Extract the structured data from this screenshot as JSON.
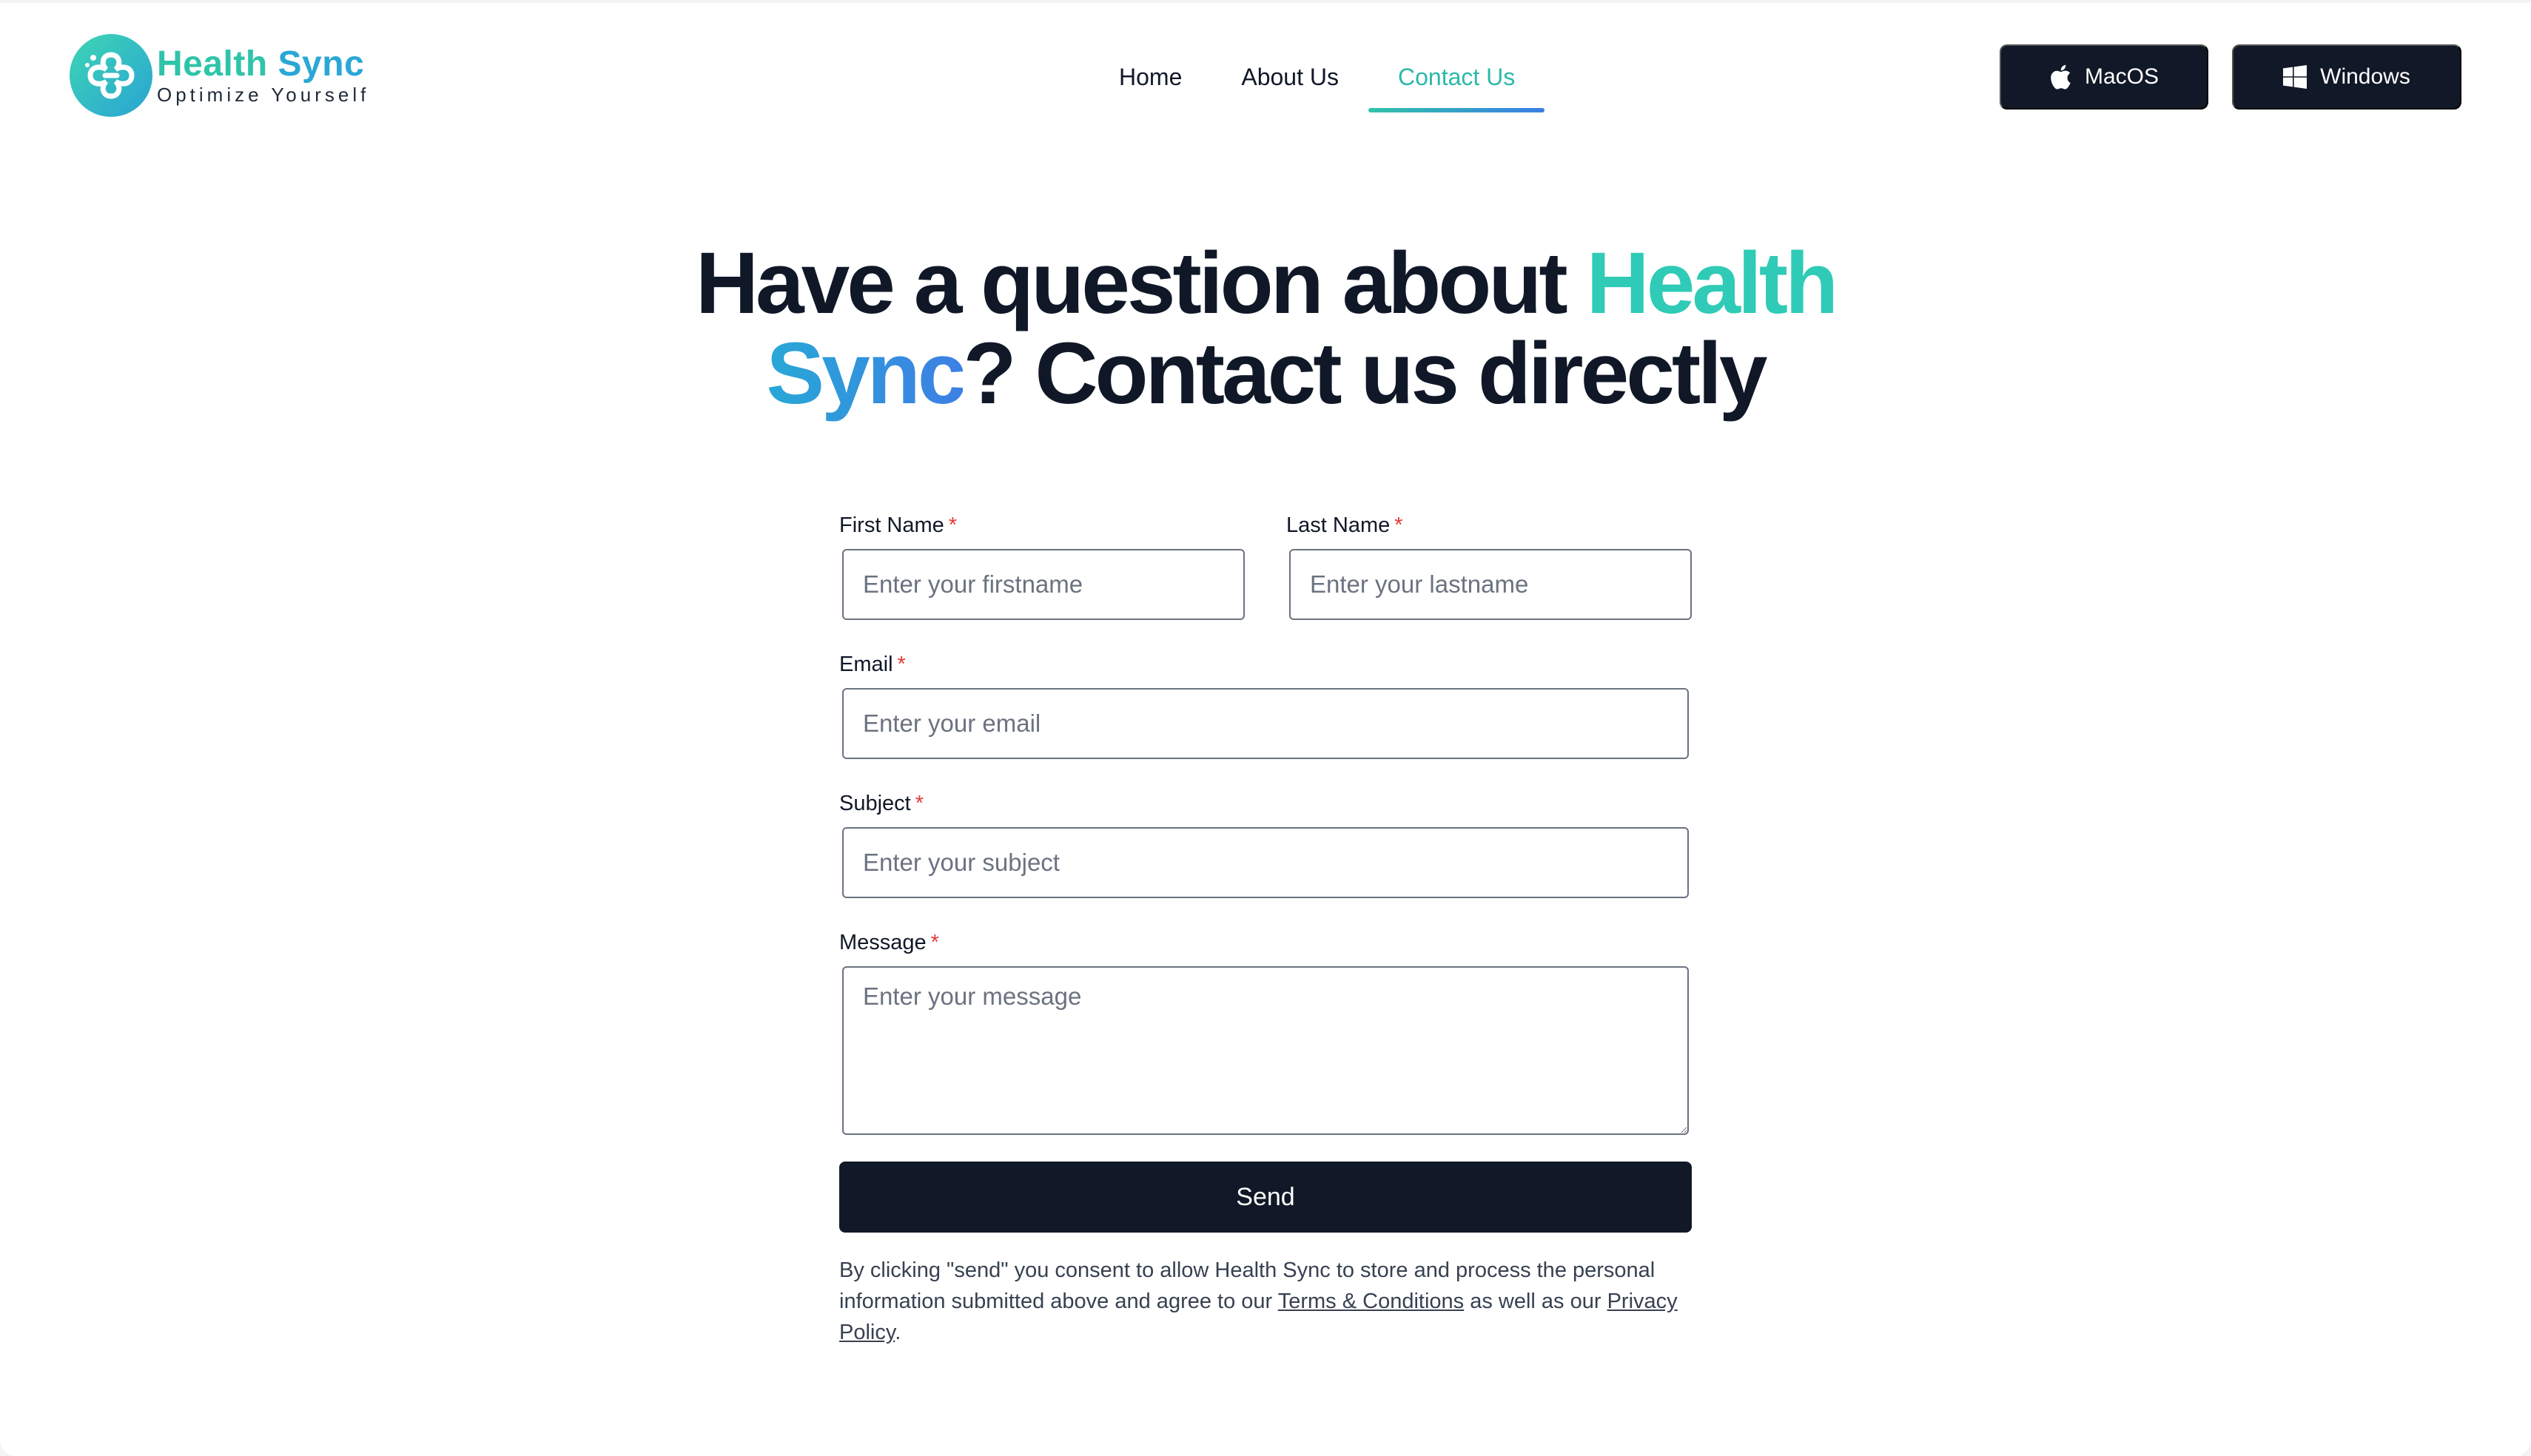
{
  "brand": {
    "name_part1": "Health",
    "name_part2": " Sync",
    "tagline": "Optimize Yourself",
    "colors": {
      "teal": "#2fc4a8",
      "blue": "#3b7ee6",
      "dark": "#111827"
    }
  },
  "nav": {
    "items": [
      {
        "label": "Home",
        "active": false
      },
      {
        "label": "About Us",
        "active": false
      },
      {
        "label": "Contact Us",
        "active": true
      }
    ]
  },
  "downloads": {
    "mac": {
      "label": "MacOS",
      "icon": "apple-icon"
    },
    "windows": {
      "label": "Windows",
      "icon": "windows-icon"
    }
  },
  "hero": {
    "part1": "Have a question about ",
    "accent1": "Health",
    "accent2": "Sync",
    "part2": "? Contact us directly"
  },
  "form": {
    "first_name": {
      "label": "First Name",
      "required_mark": "*",
      "placeholder": "Enter your firstname",
      "value": ""
    },
    "last_name": {
      "label": "Last Name",
      "required_mark": "*",
      "placeholder": "Enter your lastname",
      "value": ""
    },
    "email": {
      "label": "Email",
      "required_mark": "*",
      "placeholder": "Enter your email",
      "value": ""
    },
    "subject": {
      "label": "Subject",
      "required_mark": "*",
      "placeholder": "Enter your subject",
      "value": ""
    },
    "message": {
      "label": "Message",
      "required_mark": "*",
      "placeholder": "Enter your message",
      "value": ""
    },
    "send_label": "Send"
  },
  "consent": {
    "text_before": "By clicking \"send\" you consent to allow Health Sync to store and process the personal information submitted above and agree to our ",
    "terms_link": "Terms & Conditions",
    "text_middle": " as well as our ",
    "privacy_link": "Privacy Policy",
    "text_after": "."
  }
}
